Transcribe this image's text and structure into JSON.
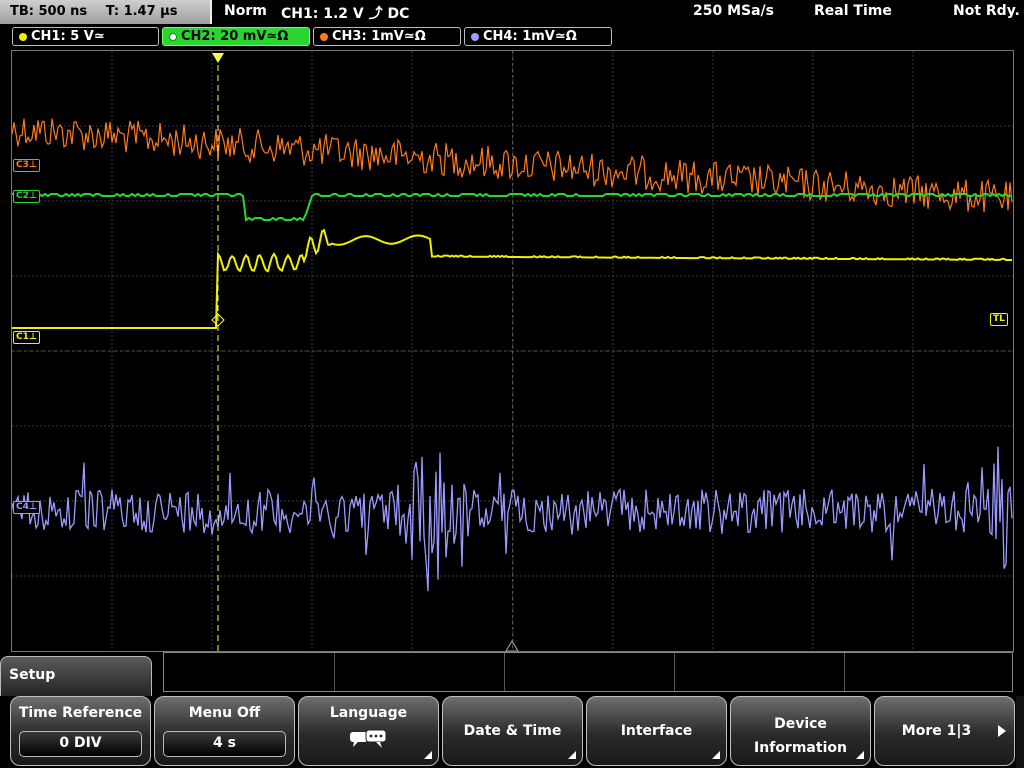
{
  "status": {
    "timebase": "TB: 500 ns",
    "trigger_time": "T: 1.47 µs",
    "mode": "Norm",
    "trigger_setting": "CH1: 1.2 V ⤴ DC",
    "sample_rate": "250 MSa/s",
    "acq_mode": "Real Time",
    "run_state": "Not Rdy."
  },
  "channels": [
    {
      "label": "CH1: 5 V≃",
      "color": "#f0f000",
      "active": false
    },
    {
      "label": "CH2: 20 mV≃Ω",
      "color": "#29d62f",
      "active": true
    },
    {
      "label": "CH3: 1mV≃Ω",
      "color": "#ff7a1a",
      "active": false
    },
    {
      "label": "CH4: 1mV≃Ω",
      "color": "#9a9aff",
      "active": false
    }
  ],
  "markers": {
    "c3": "C3⊥",
    "c2": "C2⊥",
    "c1": "C1⊥",
    "c4": "C4⊥",
    "tl": "TL",
    "trigger": "T"
  },
  "menu": {
    "title": "Setup",
    "buttons": [
      {
        "label": "Time Reference",
        "value": "0 DIV",
        "icon": ""
      },
      {
        "label": "Menu Off",
        "value": "4 s",
        "icon": ""
      },
      {
        "label": "Language",
        "value": "",
        "icon": "speech-bubble-icon"
      },
      {
        "label": "Date & Time",
        "value": "",
        "icon": "submenu-corner-icon"
      },
      {
        "label": "Interface",
        "value": "",
        "icon": "submenu-corner-icon"
      },
      {
        "label": "Device\nInformation",
        "value": "",
        "icon": "submenu-corner-icon"
      },
      {
        "label": "More 1|3",
        "value": "",
        "icon": "arrow-right-icon"
      }
    ]
  }
}
